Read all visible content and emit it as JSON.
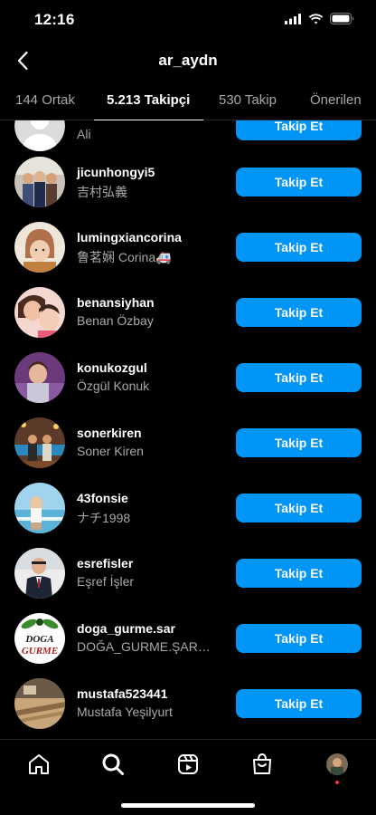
{
  "status_bar": {
    "time": "12:16"
  },
  "header": {
    "title": "ar_aydn"
  },
  "tabs": [
    {
      "label": "144 Ortak"
    },
    {
      "label": "5.213 Takipçi"
    },
    {
      "label": "530 Takip"
    },
    {
      "label": "Önerilen"
    }
  ],
  "list": {
    "follow_label": "Takip Et",
    "items": [
      {
        "username": "",
        "fullname": "Ali"
      },
      {
        "username": "jicunhongyi5",
        "fullname": "吉村弘義"
      },
      {
        "username": "lumingxiancorina",
        "fullname": "鲁茗娴 Corina🚑"
      },
      {
        "username": "benansiyhan",
        "fullname": "Benan Özbay"
      },
      {
        "username": "konukozgul",
        "fullname": "Özgül Konuk"
      },
      {
        "username": "sonerkiren",
        "fullname": "Soner Kiren"
      },
      {
        "username": "43fonsie",
        "fullname": "ナチ1998"
      },
      {
        "username": "esrefisler",
        "fullname": "Eşref İşler"
      },
      {
        "username": "doga_gurme.sar",
        "fullname": "DOĞA_GURME.ŞARKÜTERİ"
      },
      {
        "username": "mustafa523441",
        "fullname": "Mustafa Yeşilyurt"
      }
    ]
  },
  "doga_logo": {
    "line1": "DOGA",
    "line2": "GURME"
  },
  "colors": {
    "background": "#000000",
    "primary_button": "#0095f6",
    "secondary_text": "#a8a8a8",
    "notification_dot": "#ff3040"
  },
  "icons": {
    "back": "chevron-left-icon",
    "home": "home-icon",
    "search": "search-icon",
    "reels": "reels-icon",
    "shop": "shop-icon",
    "profile": "profile-avatar"
  }
}
